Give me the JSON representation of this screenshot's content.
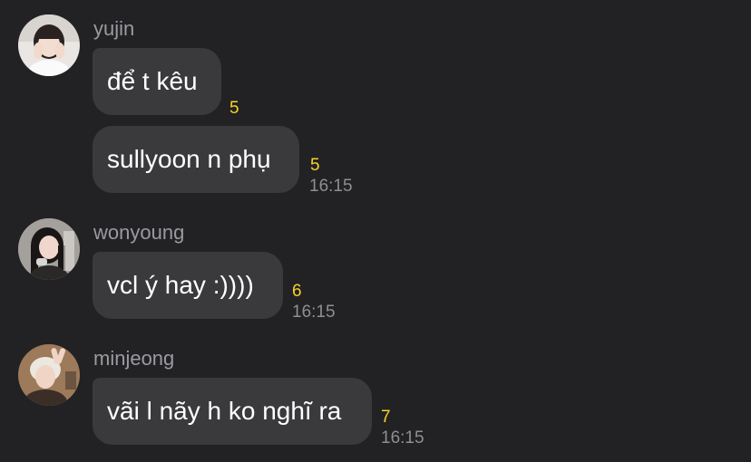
{
  "messages": [
    {
      "sender": "yujin",
      "avatar_icon": "profile-photo-yujin",
      "bubbles": [
        {
          "text": "để t kêu",
          "unread": "5"
        },
        {
          "text": "sullyoon n phụ",
          "unread": "5",
          "time": "16:15"
        }
      ]
    },
    {
      "sender": "wonyoung",
      "avatar_icon": "profile-photo-wonyoung",
      "bubbles": [
        {
          "text": "vcl ý hay :))))",
          "unread": "6",
          "time": "16:15"
        }
      ]
    },
    {
      "sender": "minjeong",
      "avatar_icon": "profile-photo-minjeong",
      "bubbles": [
        {
          "text": "vãi l nãy h ko nghĩ ra",
          "unread": "7",
          "time": "16:15"
        }
      ]
    }
  ],
  "colors": {
    "background": "#222224",
    "bubble": "#3a3a3c",
    "unread": "#f7d22a",
    "sender": "#9a9aa0",
    "time": "#8e8e93"
  }
}
